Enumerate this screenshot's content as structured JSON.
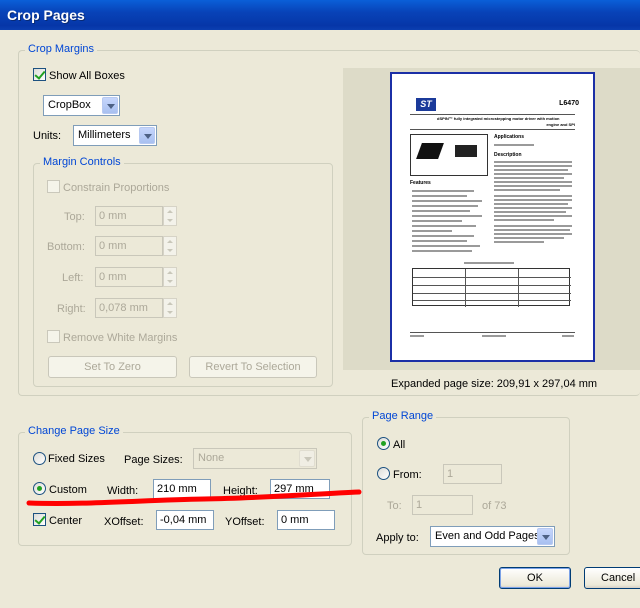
{
  "window": {
    "title": "Crop Pages"
  },
  "crop_margins": {
    "legend": "Crop Margins",
    "show_all_boxes": {
      "label": "Show All Boxes",
      "checked": true
    },
    "box_select": {
      "value": "CropBox"
    },
    "units": {
      "label": "Units:",
      "value": "Millimeters"
    },
    "margin_controls": {
      "legend": "Margin Controls",
      "constrain": {
        "label": "Constrain Proportions",
        "checked": false
      },
      "top": {
        "label": "Top:",
        "value": "0 mm"
      },
      "bottom": {
        "label": "Bottom:",
        "value": "0 mm"
      },
      "left": {
        "label": "Left:",
        "value": "0 mm"
      },
      "right": {
        "label": "Right:",
        "value": "0,078 mm"
      },
      "remove_white": {
        "label": "Remove White Margins",
        "checked": false
      },
      "set_to_zero_label": "Set To Zero",
      "revert_label": "Revert To Selection"
    }
  },
  "preview": {
    "expanded_size": "Expanded page size: 209,91 x 297,04 mm",
    "doc": {
      "part_number": "L6470",
      "logo": "ST",
      "subtitle_1": "dSPIN™ fully integrated microstepping motor driver with motion",
      "subtitle_2": "engine and SPI",
      "section_applications": "Applications",
      "section_description": "Description",
      "section_features": "Features"
    }
  },
  "change_page_size": {
    "legend": "Change Page Size",
    "fixed_sizes": {
      "label": "Fixed Sizes",
      "selected": false
    },
    "page_sizes": {
      "label": "Page Sizes:",
      "value": "None"
    },
    "custom": {
      "label": "Custom",
      "selected": true
    },
    "width": {
      "label": "Width:",
      "value": "210 mm"
    },
    "height": {
      "label": "Height:",
      "value": "297 mm"
    },
    "center": {
      "label": "Center",
      "checked": true
    },
    "xoffset": {
      "label": "XOffset:",
      "value": "-0,04 mm"
    },
    "yoffset": {
      "label": "YOffset:",
      "value": "0 mm"
    }
  },
  "page_range": {
    "legend": "Page Range",
    "all": {
      "label": "All",
      "selected": true
    },
    "from": {
      "label": "From:",
      "value": "1"
    },
    "to": {
      "label": "To:",
      "value": "1"
    },
    "of_total": "of 73",
    "apply_to": {
      "label": "Apply to:",
      "value": "Even and Odd Pages"
    }
  },
  "buttons": {
    "ok": "OK",
    "cancel": "Cancel"
  },
  "colors": {
    "title_bar": "#0a5fd8",
    "group_legend": "#0046d5",
    "annotation_red": "#ff0000",
    "check_green": "#21a121"
  }
}
